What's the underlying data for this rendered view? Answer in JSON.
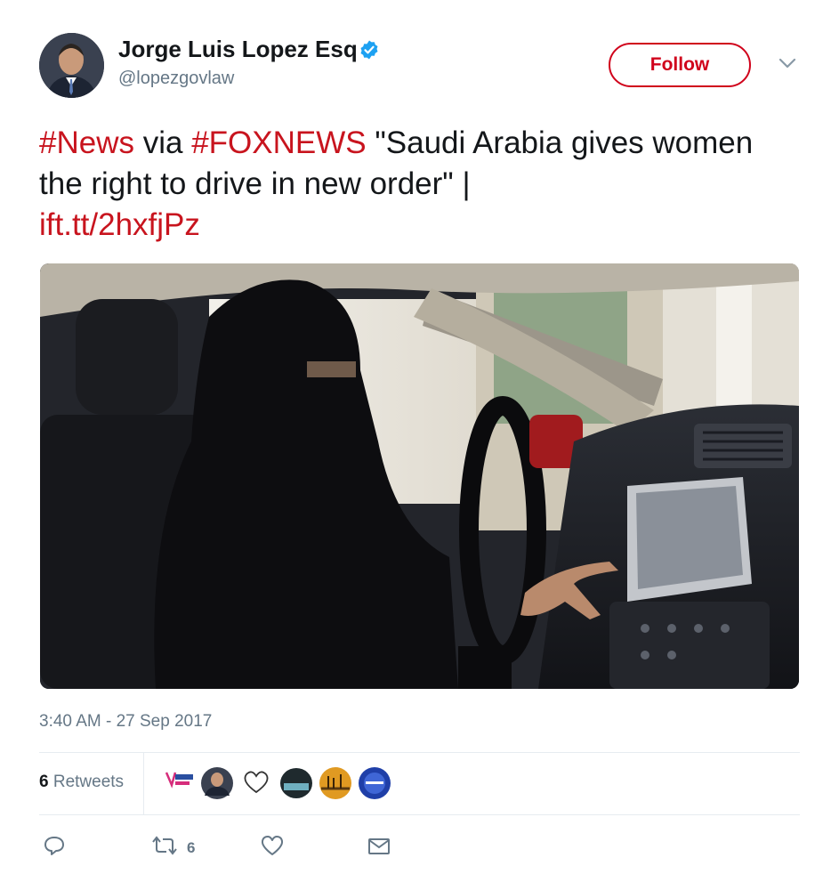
{
  "author": {
    "name": "Jorge Luis Lopez Esq",
    "handle": "@lopezgovlaw",
    "verified": true
  },
  "follow_label": "Follow",
  "tweet": {
    "hashtag1": "#News",
    "via": " via ",
    "hashtag2": "#FOXNEWS",
    "quote": " \"Saudi Arabia gives women the right to drive in new order\" | ",
    "link": "ift.tt/2hxfjPz"
  },
  "timestamp": "3:40 AM - 27 Sep 2017",
  "retweets": {
    "count": "6",
    "label": "Retweets"
  },
  "actions": {
    "retweet_count": "6"
  },
  "colors": {
    "accent": "#c8141e",
    "follow_border": "#d0021b",
    "secondary_text": "#657786",
    "verified_blue": "#1da1f2"
  },
  "icons": [
    "verified-badge-icon",
    "chevron-down-icon",
    "reply-icon",
    "retweet-icon",
    "like-icon",
    "message-icon"
  ]
}
